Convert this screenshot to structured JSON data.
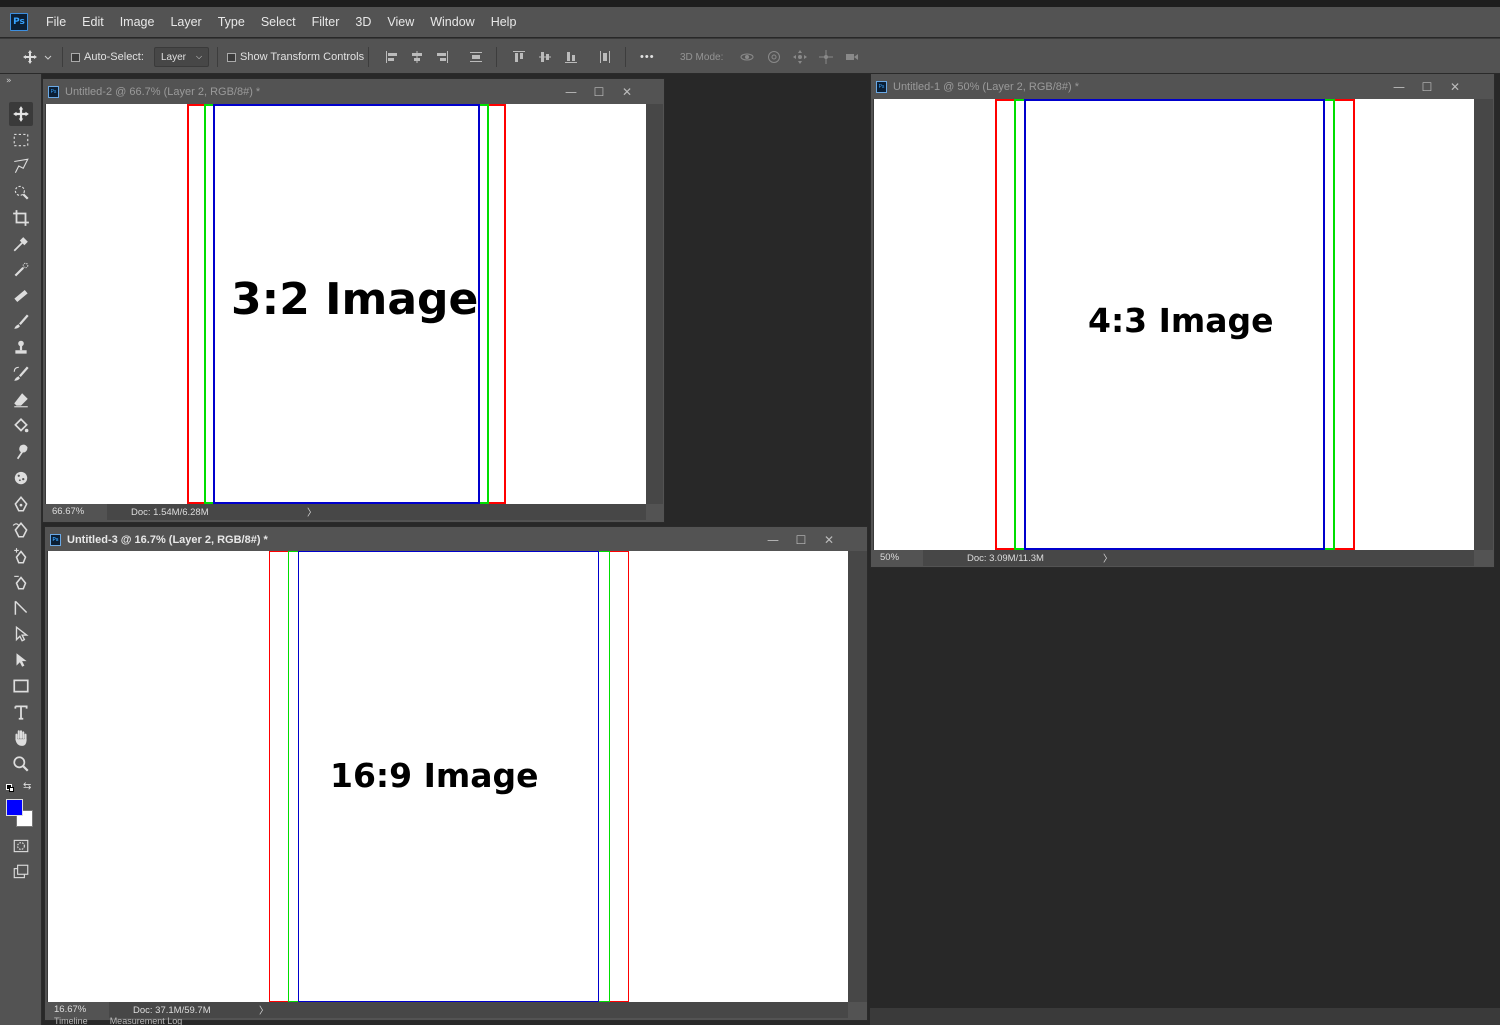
{
  "app": {
    "logo": "Ps"
  },
  "menu": [
    "File",
    "Edit",
    "Image",
    "Layer",
    "Type",
    "Select",
    "Filter",
    "3D",
    "View",
    "Window",
    "Help"
  ],
  "options": {
    "auto_select_label": "Auto-Select:",
    "auto_select_value": "Layer",
    "show_transform_label": "Show Transform Controls",
    "more_label": "•••",
    "mode_label": "3D Mode:"
  },
  "colors": {
    "foreground": "#0000ff",
    "background": "#ffffff",
    "outer_rect": "#ff0000",
    "middle_rect": "#00dd00",
    "inner_rect": "#0000cc"
  },
  "documents": [
    {
      "title": "Untitled-2 @ 66.7% (Layer 2, RGB/8#) *",
      "label": "3:2 Image",
      "zoom": "66.67%",
      "docinfo": "Doc: 1.54M/6.28M",
      "active": false
    },
    {
      "title": "Untitled-1 @ 50% (Layer 2, RGB/8#) *",
      "label": "4:3 Image",
      "zoom": "50%",
      "docinfo": "Doc: 3.09M/11.3M",
      "active": false
    },
    {
      "title": "Untitled-3 @ 16.7% (Layer 2, RGB/8#) *",
      "label": "16:9 Image",
      "zoom": "16.67%",
      "docinfo": "Doc: 37.1M/59.7M",
      "active": true
    }
  ],
  "window_buttons": {
    "minimize": "—",
    "maximize": "☐",
    "close": "✕"
  },
  "status_arrow": "〉",
  "bottom_tabs": [
    "Timeline",
    "Measurement Log"
  ]
}
